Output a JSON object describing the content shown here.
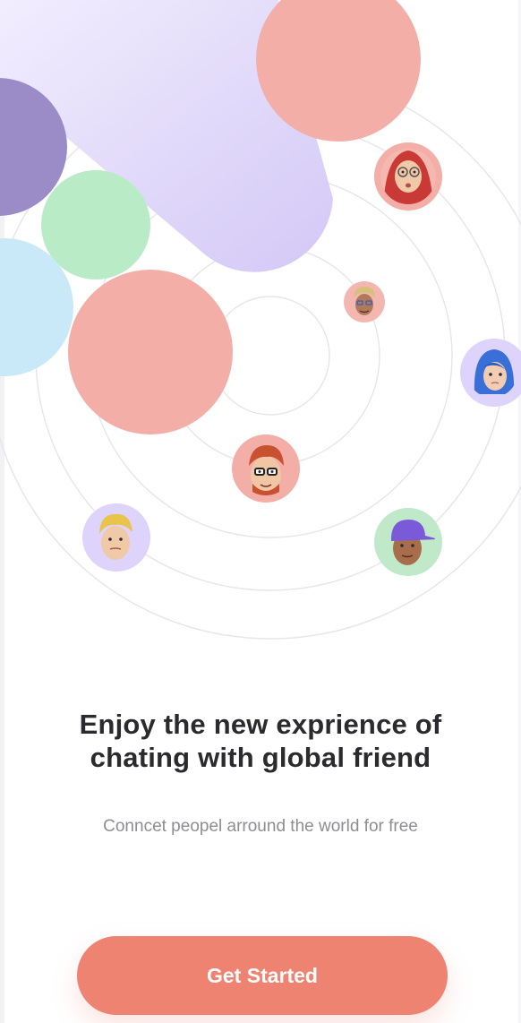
{
  "onboarding": {
    "headline_line1": "Enjoy the new exprience of",
    "headline_line2": "chating with global friend",
    "subtext": "Conncet peopel arround the world for free",
    "cta_label": "Get Started"
  },
  "colors": {
    "accent": "#ed8370",
    "salmon": "#f2aea7",
    "lavender": "#9b8cc8",
    "mint": "#b9ebc6",
    "sky": "#c9e8f8",
    "purple_band": "#d9d1f7",
    "heading_text": "#2b2b2f",
    "sub_text": "#8d8d93"
  },
  "avatars": [
    {
      "name": "woman-hijab-avatar",
      "ring": "#f2aea7"
    },
    {
      "name": "man-curly-hair-avatar",
      "ring": "#f4b6b0"
    },
    {
      "name": "blue-hair-avatar",
      "ring": "#ddd3fb"
    },
    {
      "name": "red-hair-glasses-avatar",
      "ring": "#f2aea7"
    },
    {
      "name": "blond-man-avatar",
      "ring": "#ddd3fb"
    },
    {
      "name": "cap-boy-avatar",
      "ring": "#bfe9c8"
    }
  ]
}
